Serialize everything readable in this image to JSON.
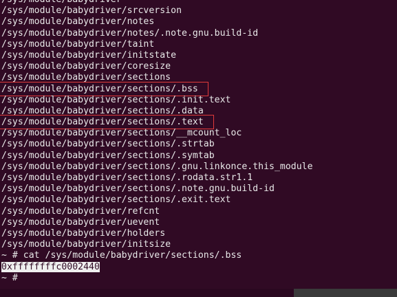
{
  "terminal": {
    "lines": [
      "/sys/module/babydriver",
      "/sys/module/babydriver/srcversion",
      "/sys/module/babydriver/notes",
      "/sys/module/babydriver/notes/.note.gnu.build-id",
      "/sys/module/babydriver/taint",
      "/sys/module/babydriver/initstate",
      "/sys/module/babydriver/coresize",
      "/sys/module/babydriver/sections",
      "/sys/module/babydriver/sections/.bss",
      "/sys/module/babydriver/sections/.init.text",
      "/sys/module/babydriver/sections/.data",
      "/sys/module/babydriver/sections/.text",
      "/sys/module/babydriver/sections/__mcount_loc",
      "/sys/module/babydriver/sections/.strtab",
      "/sys/module/babydriver/sections/.symtab",
      "/sys/module/babydriver/sections/.gnu.linkonce.this_module",
      "/sys/module/babydriver/sections/.rodata.str1.1",
      "/sys/module/babydriver/sections/.note.gnu.build-id",
      "/sys/module/babydriver/sections/.exit.text",
      "/sys/module/babydriver/refcnt",
      "/sys/module/babydriver/uevent",
      "/sys/module/babydriver/holders",
      "/sys/module/babydriver/initsize",
      "~ # cat /sys/module/babydriver/sections/.bss",
      "0xffffffffc0002440",
      "~ # "
    ],
    "highlight_color": "#e23b3b",
    "background_color": "#300a24",
    "text_color": "#e8e8e8"
  }
}
